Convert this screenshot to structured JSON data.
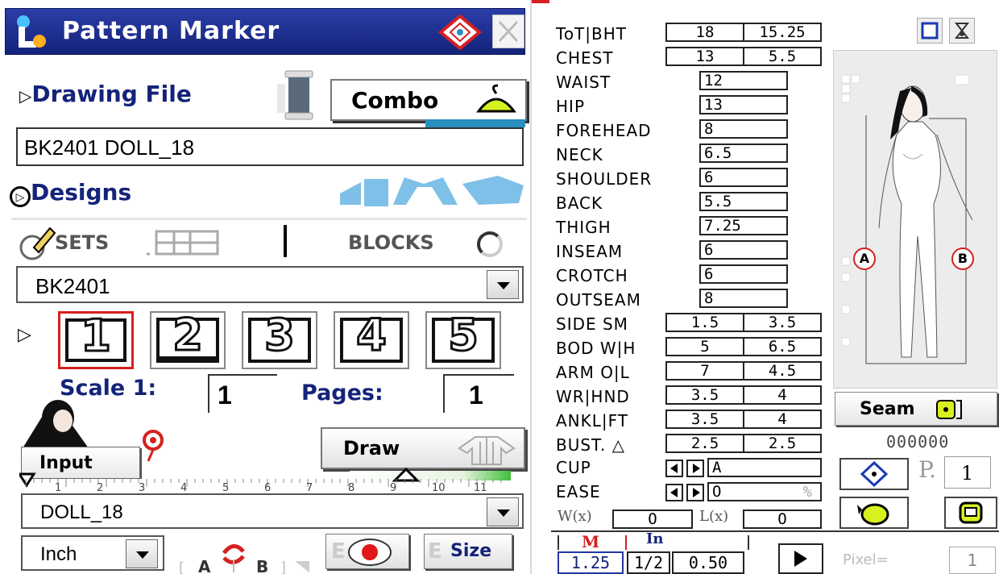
{
  "window": {
    "title": "Pattern Marker"
  },
  "left": {
    "drawing_file_header": "Drawing File",
    "combo_label": "Combo",
    "file_name": "BK2401 DOLL_18",
    "designs_header": "Designs",
    "sets_label": "SETS",
    "blocks_label": "BLOCKS",
    "design_selected": "BK2401",
    "page_buttons": [
      "1",
      "2",
      "3",
      "4",
      "5"
    ],
    "scale_label": "Scale 1:",
    "scale_value": "1",
    "pages_label": "Pages:",
    "pages_value": "1",
    "input_label": "Input",
    "draw_label": "Draw",
    "ruler_ticks": [
      "1",
      "2",
      "3",
      "4",
      "5",
      "6",
      "7",
      "8",
      "9",
      "10",
      "11"
    ],
    "pattern_selected": "DOLL_18",
    "unit_selected": "Inch",
    "swap_a": "A",
    "swap_b": "B",
    "size_label": "Size",
    "size_prefix": "E",
    "record_prefix": "E"
  },
  "measurements": [
    {
      "label": "ToT|BHT",
      "v1": "18",
      "v2": "15.25"
    },
    {
      "label": "CHEST",
      "v1": "13",
      "v2": "5.5"
    },
    {
      "label": "WAIST",
      "v1": "12"
    },
    {
      "label": "HIP",
      "v1": "13"
    },
    {
      "label": "FOREHEAD",
      "v1": "8"
    },
    {
      "label": "NECK",
      "v1": "6.5"
    },
    {
      "label": "SHOULDER",
      "v1": "6"
    },
    {
      "label": "BACK",
      "v1": "5.5"
    },
    {
      "label": "THIGH",
      "v1": "7.25"
    },
    {
      "label": "INSEAM",
      "v1": "6"
    },
    {
      "label": "CROTCH",
      "v1": "6"
    },
    {
      "label": "OUTSEAM",
      "v1": "8"
    },
    {
      "label": "SIDE SM",
      "v1": "1.5",
      "v2": "3.5"
    },
    {
      "label": "BOD W|H",
      "v1": "5",
      "v2": "6.5"
    },
    {
      "label": "ARM O|L",
      "v1": "7",
      "v2": "4.5"
    },
    {
      "label": "WR|HND",
      "v1": "3.5",
      "v2": "4"
    },
    {
      "label": "ANKL|FT",
      "v1": "3.5",
      "v2": "4"
    },
    {
      "label": "BUST. △",
      "v1": "2.5",
      "v2": "2.5"
    }
  ],
  "cup": {
    "label": "CUP",
    "value": "A"
  },
  "ease": {
    "label": "EASE",
    "value": "O",
    "unit": "%"
  },
  "wl": {
    "w_label": "W(x)",
    "w_value": "O",
    "l_label": "L(x)",
    "l_value": "O"
  },
  "figure": {
    "marker_a": "A",
    "marker_b": "B"
  },
  "seam": {
    "label": "Seam",
    "counter": "000000"
  },
  "page_nav": {
    "p_label": "P.",
    "p_value": "1"
  },
  "bottom": {
    "m_label": "M",
    "in_label": "In",
    "m_value": "1.25",
    "frac_value": "1/2",
    "dec_value": "0.50",
    "pixel_label": "Pixel=",
    "pixel_value": "1"
  },
  "colors": {
    "title_bar": "#1a2a8a",
    "accent_blue": "#14237a",
    "accent_red": "#d42020"
  }
}
